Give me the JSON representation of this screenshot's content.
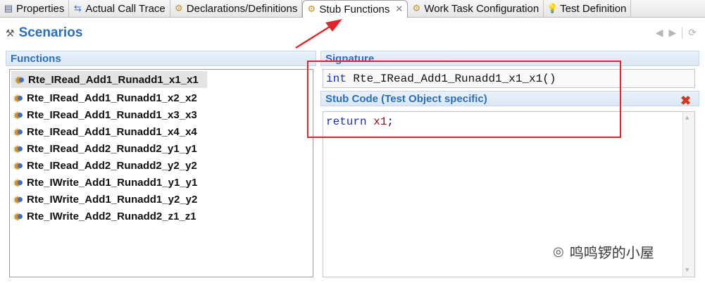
{
  "tabs": [
    {
      "label": "Properties",
      "icon": "properties-icon"
    },
    {
      "label": "Actual Call Trace",
      "icon": "call-trace-icon"
    },
    {
      "label": "Declarations/Definitions",
      "icon": "declarations-icon"
    },
    {
      "label": "Stub Functions",
      "icon": "stub-functions-icon",
      "active": true
    },
    {
      "label": "Work Task Configuration",
      "icon": "work-task-icon"
    },
    {
      "label": "Test Definition",
      "icon": "lightbulb-icon"
    }
  ],
  "header": {
    "title": "Scenarios"
  },
  "functions_panel": {
    "title": "Functions",
    "items": [
      "Rte_IRead_Add1_Runadd1_x1_x1",
      "Rte_IRead_Add1_Runadd1_x2_x2",
      "Rte_IRead_Add1_Runadd1_x3_x3",
      "Rte_IRead_Add1_Runadd1_x4_x4",
      "Rte_IRead_Add2_Runadd2_y1_y1",
      "Rte_IRead_Add2_Runadd2_y2_y2",
      "Rte_IWrite_Add1_Runadd1_y1_y1",
      "Rte_IWrite_Add1_Runadd1_y2_y2",
      "Rte_IWrite_Add2_Runadd2_z1_z1"
    ],
    "selected_index": 0
  },
  "signature": {
    "title": "Signature",
    "keyword": "int",
    "rest": " Rte_IRead_Add1_Runadd1_x1_x1()"
  },
  "stub_code": {
    "title": "Stub Code (Test Object specific)",
    "keyword": "return",
    "variable": "x1",
    "terminator": ";"
  },
  "watermark": "鸣鸣锣的小屋",
  "colors": {
    "accent": "#2a6fb8",
    "highlight": "#e0262b",
    "keyword": "#1a2fb0"
  }
}
